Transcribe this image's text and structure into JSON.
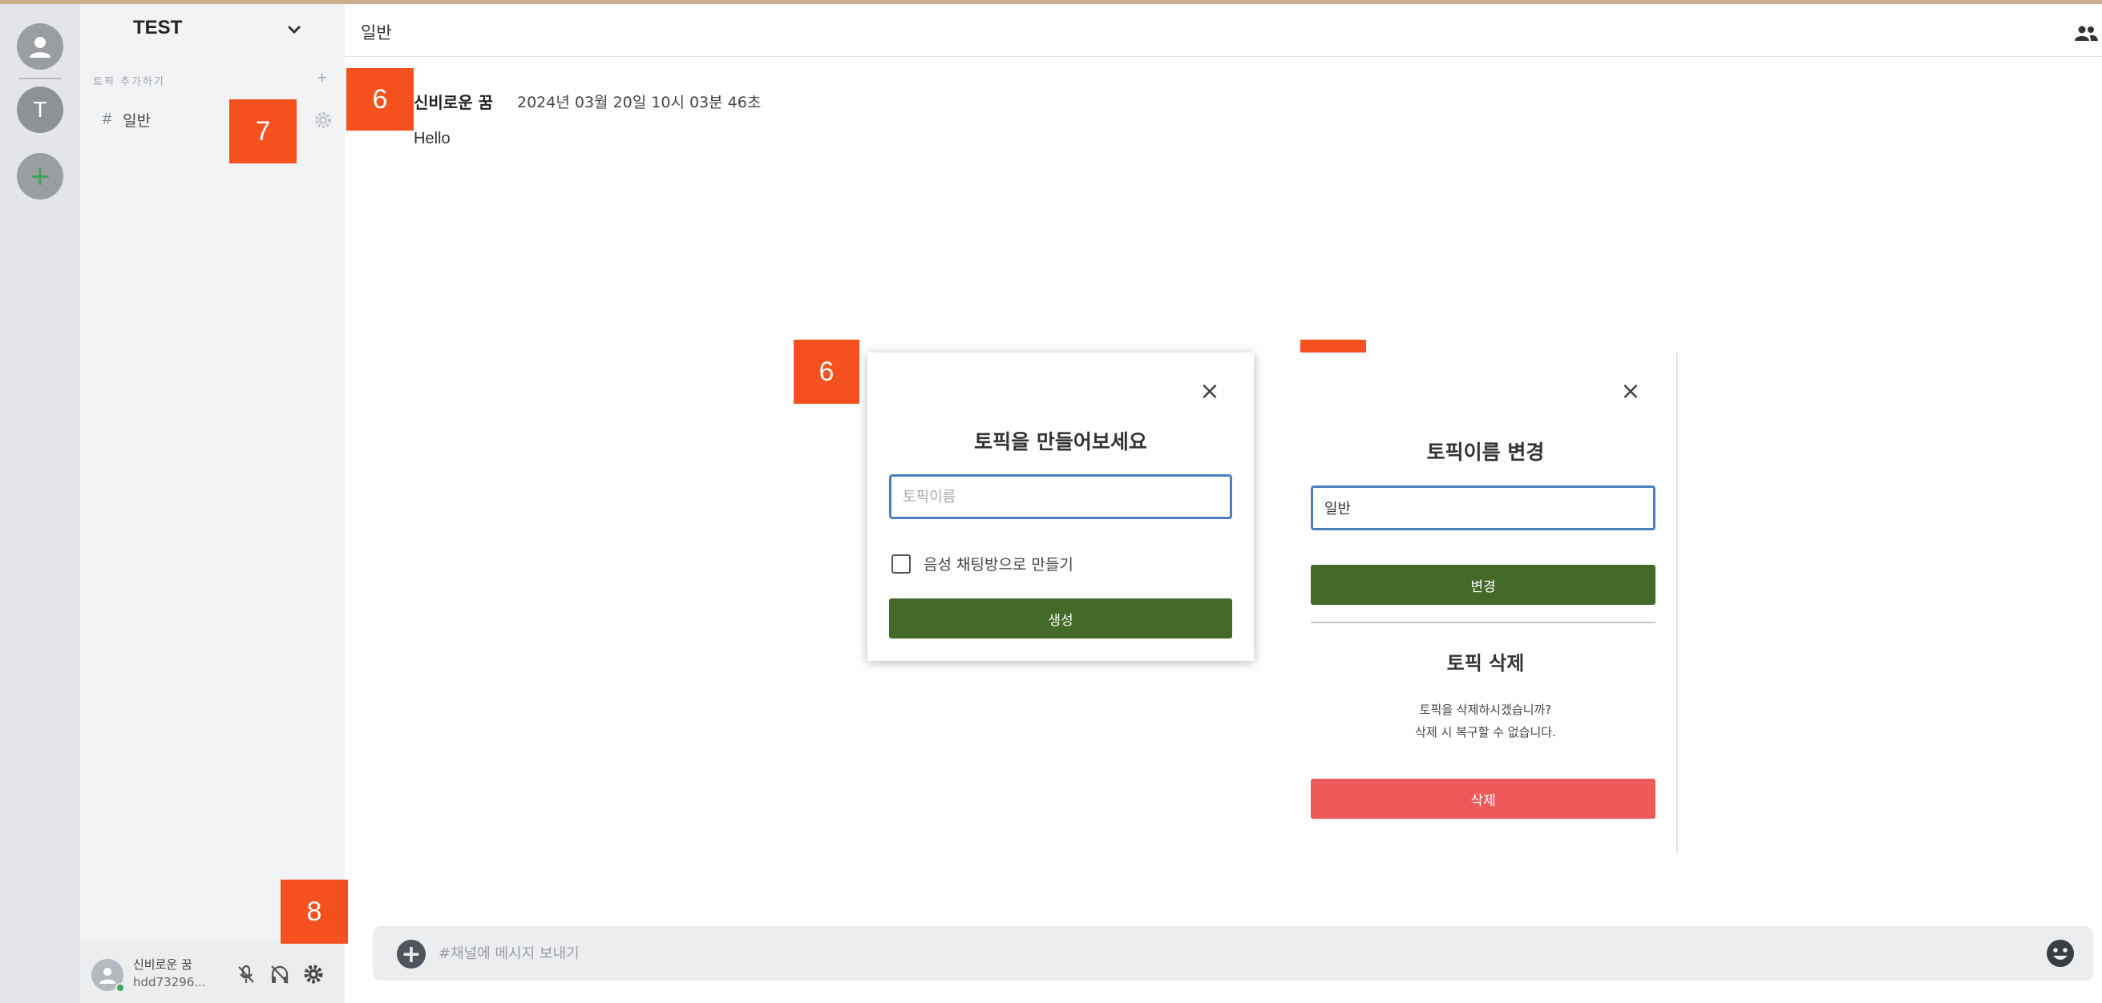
{
  "server": {
    "name": "TEST",
    "initial": "T"
  },
  "sidebar": {
    "add_topic_label": "토픽 추가하기",
    "add_topic_plus": "+",
    "channels": [
      {
        "hash": "#",
        "name": "일반"
      }
    ]
  },
  "user": {
    "name": "신비로운 꿈",
    "tag": "hdd73296..."
  },
  "header": {
    "channel_title": "일반"
  },
  "message": {
    "author": "신비로운 꿈",
    "time": "2024년 03월 20일 10시 03분 46초",
    "text": "Hello"
  },
  "badges": {
    "b6": "6",
    "b7": "7",
    "b8": "8"
  },
  "create_modal": {
    "close": "×",
    "title": "토픽을 만들어보세요",
    "input_placeholder": "토픽이름",
    "checkbox_label": "음성 채팅방으로 만들기",
    "create_button": "생성"
  },
  "rename_modal": {
    "close": "×",
    "title": "토픽이름 변경",
    "input_value": "일반",
    "change_button": "변경",
    "delete_title": "토픽 삭제",
    "delete_question": "토픽을 삭제하시겠습니까?",
    "delete_warning": "삭제 시 복구할 수 없습니다.",
    "delete_button": "삭제"
  },
  "composer": {
    "placeholder": "#채널에 메시지 보내기",
    "plus": "+"
  },
  "colors": {
    "accent_green": "#446a2a",
    "danger_red": "#ec5a5a",
    "badge_orange": "#f4511e",
    "online_green": "#3ba55c"
  },
  "icons": [
    "user-icon",
    "plus-icon",
    "chevron-down-icon",
    "gear-icon",
    "mic-muted-icon",
    "headphones-muted-icon",
    "members-icon",
    "close-icon",
    "emoji-icon"
  ]
}
